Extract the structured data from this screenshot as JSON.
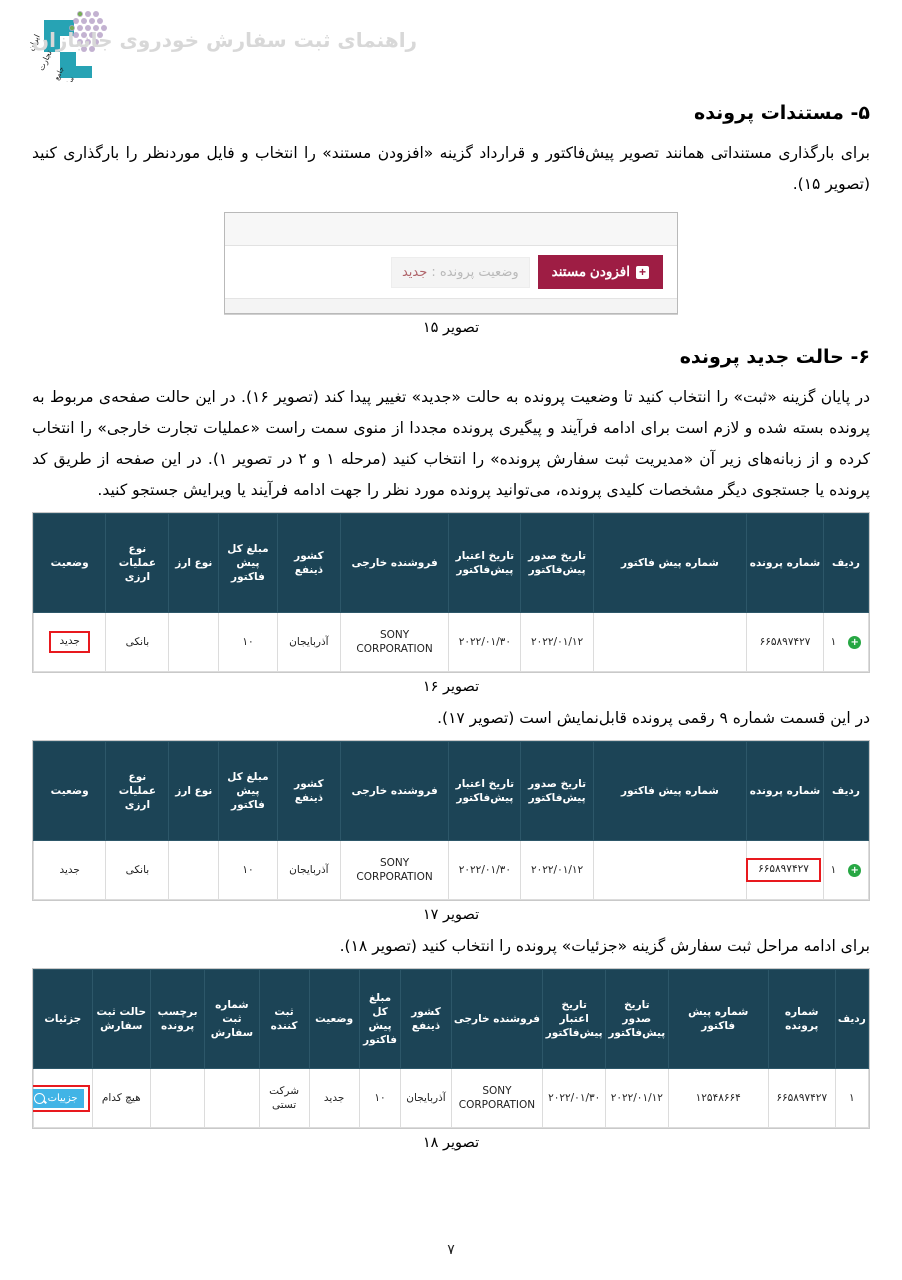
{
  "header": {
    "title": "راهنمای ثبت سفارش خودروی جانبازان",
    "logo_icon": "iran-trade-system-logo"
  },
  "sections": [
    {
      "number_title": "۵- مستندات پرونده",
      "paragraph": "برای بارگذاری مستنداتی همانند تصویر پیش‌فاکتور و قرارداد گزینه «افزودن مستند» را انتخاب و فایل موردنظر را بارگذاری کنید (تصویر ۱۵)."
    },
    {
      "number_title": "۶- حالت جدید پرونده",
      "paragraph": "در پایان گزینه «ثبت» را انتخاب کنید تا وضعیت پرونده به حالت «جدید» تغییر پیدا کند (تصویر ۱۶). در این حالت صفحه‌ی مربوط به پرونده بسته شده و لازم است برای ادامه فرآیند و پیگیری پرونده مجددا از منوی سمت راست «عملیات تجارت خارجی» را انتخاب کرده و از زبانه‌های زیر آن «مدیریت ثبت سفارش پرونده» را انتخاب کنید (مرحله ۱ و ۲ در تصویر ۱). در این صفحه از طریق کد پرونده یا جستجوی دیگر مشخصات کلیدی پرونده، می‌توانید پرونده مورد نظر را جهت ادامه فرآیند یا ویرایش جستجو کنید."
    }
  ],
  "figure15": {
    "status_label": "وضعیت پرونده : ",
    "status_value": "جدید",
    "add_document_button": "افزودن مستند",
    "plus_icon": "plus-icon",
    "caption": "تصویر ۱۵"
  },
  "figure16": {
    "caption": "تصویر ۱۶",
    "columns": [
      "ردیف",
      "شماره پرونده",
      "شماره پیش فاکتور",
      "تاریخ صدور پیش‌فاکتور",
      "تاریخ اعتبار پیش‌فاکتور",
      "فروشنده خارجی",
      "کشور ذینفع",
      "مبلغ کل پیش فاکتور",
      "نوع ارز",
      "نوع عملیات ارزی",
      "وضعیت"
    ],
    "row": {
      "index": "۱",
      "case_number": "۶۶۵۸۹۷۴۲۷",
      "proforma_number": "",
      "issue_date": "۲۰۲۲/۰۱/۱۲",
      "validity_date": "۲۰۲۲/۰۱/۳۰",
      "foreign_seller": "SONY CORPORATION",
      "beneficiary_country": "آذربایجان",
      "total_amount": "۱۰",
      "currency_type": "",
      "fx_operation_type": "بانکی",
      "status": "جدید"
    },
    "status_icon": "add-circle-icon"
  },
  "between_16_17_text": "در این قسمت شماره ۹ رقمی پرونده قابل‌نمایش است (تصویر ۱۷).",
  "figure17": {
    "caption": "تصویر ۱۷",
    "columns": [
      "ردیف",
      "شماره پرونده",
      "شماره پیش فاکتور",
      "تاریخ صدور پیش‌فاکتور",
      "تاریخ اعتبار پیش‌فاکتور",
      "فروشنده خارجی",
      "کشور ذینفع",
      "مبلغ کل پیش فاکتور",
      "نوع ارز",
      "نوع عملیات ارزی",
      "وضعیت"
    ],
    "row": {
      "index": "۱",
      "case_number": "۶۶۵۸۹۷۴۲۷",
      "proforma_number": "",
      "issue_date": "۲۰۲۲/۰۱/۱۲",
      "validity_date": "۲۰۲۲/۰۱/۳۰",
      "foreign_seller": "SONY CORPORATION",
      "beneficiary_country": "آذربایجان",
      "total_amount": "۱۰",
      "currency_type": "",
      "fx_operation_type": "بانکی",
      "status": "جدید"
    },
    "status_icon": "add-circle-icon"
  },
  "between_17_18_text": "برای ادامه مراحل ثبت سفارش گزینه «جزئیات» پرونده را انتخاب کنید (تصویر ۱۸).",
  "figure18": {
    "caption": "تصویر ۱۸",
    "columns": [
      "ردیف",
      "شماره پرونده",
      "شماره پیش فاکتور",
      "تاریخ صدور پیش‌فاکتور",
      "تاریخ اعتبار پیش‌فاکتور",
      "فروشنده خارجی",
      "کشور ذینفع",
      "مبلغ کل پیش فاکتور",
      "وضعیت",
      "ثبت کننده",
      "شماره ثبت سفارش",
      "برچسب پرونده",
      "حالت ثبت سفارش",
      "جزئیات"
    ],
    "row": {
      "index": "۱",
      "case_number": "۶۶۵۸۹۷۴۲۷",
      "proforma_number": "۱۲۵۴۸۶۶۴",
      "issue_date": "۲۰۲۲/۰۱/۱۲",
      "validity_date": "۲۰۲۲/۰۱/۳۰",
      "foreign_seller": "SONY CORPORATION",
      "beneficiary_country": "آذربایجان",
      "total_amount": "۱۰",
      "status": "جدید",
      "registrant": "شرکت تستی",
      "order_reg_number": "",
      "case_label": "",
      "order_reg_state": "هیچ کدام",
      "details_button": "جزییات"
    },
    "details_icon": "magnifier-icon"
  },
  "footer": {
    "page_number": "۷"
  },
  "colors": {
    "table_header_bg": "#1c4456",
    "highlight_border": "#e8191e",
    "primary_button": "#9e1d44",
    "details_button": "#41b4e6",
    "status_dot": "#27a744"
  }
}
